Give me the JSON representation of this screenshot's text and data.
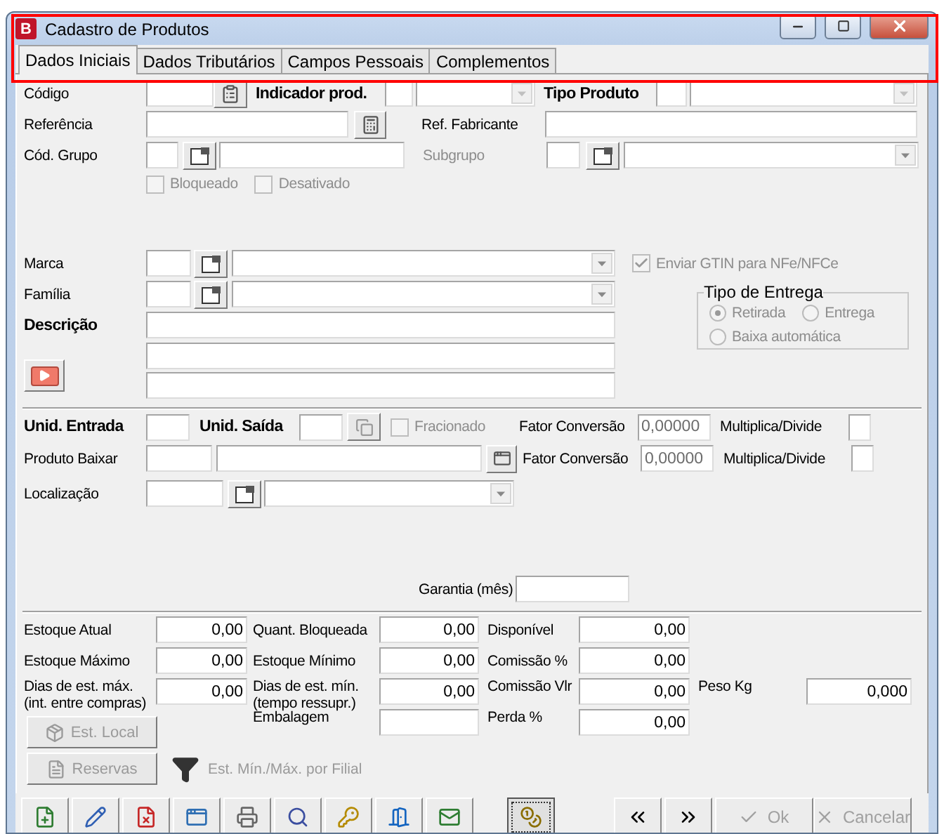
{
  "window": {
    "badge": "B",
    "title": "Cadastro de Produtos"
  },
  "tabs": [
    {
      "label": "Dados Iniciais",
      "selected": true
    },
    {
      "label": "Dados Tributários",
      "selected": false
    },
    {
      "label": "Campos Pessoais",
      "selected": false
    },
    {
      "label": "Complementos",
      "selected": false
    }
  ],
  "header": {
    "codigo_label": "Código",
    "indicador_label": "Indicador prod.",
    "tipo_label": "Tipo Produto",
    "referencia_label": "Referência",
    "ref_fabricante_label": "Ref. Fabricante",
    "cod_grupo_label": "Cód. Grupo",
    "subgrupo": {
      "label": "Subgrupo",
      "disabled": true
    }
  },
  "status_checks": [
    {
      "label": "Bloqueado",
      "checked": false,
      "disabled": true
    },
    {
      "label": "Desativado",
      "checked": false,
      "disabled": true
    }
  ],
  "product": {
    "marca_label": "Marca",
    "familia_label": "Família",
    "descricao_label": "Descrição"
  },
  "gtin": {
    "label": "Enviar GTIN para NFe/NFCe",
    "checked": true,
    "disabled": true
  },
  "tipo_entrega": {
    "title": "Tipo de Entrega",
    "disabled": true,
    "options": [
      {
        "label": "Retirada",
        "selected": true
      },
      {
        "label": "Entrega",
        "selected": false
      },
      {
        "label": "Baixa automática",
        "selected": false
      }
    ]
  },
  "unidades": {
    "entrada_label": "Unid. Entrada",
    "saida_label": "Unid. Saída",
    "fracionado": {
      "label": "Fracionado",
      "checked": false,
      "disabled": true
    },
    "produto_baixar_label": "Produto Baixar",
    "localizacao_label": "Localização",
    "conversions": [
      {
        "label": "Fator Conversão",
        "value": "0,00000",
        "mult_label": "Multiplica/Divide"
      },
      {
        "label": "Fator Conversão",
        "value": "0,00000",
        "mult_label": "Multiplica/Divide"
      }
    ]
  },
  "garantia_label": "Garantia (mês)",
  "stock": {
    "rows": [
      [
        {
          "label": "Estoque Atual",
          "value": "0,00"
        },
        {
          "label": "Quant. Bloqueada",
          "value": "0,00"
        },
        {
          "label": "Disponível",
          "value": "0,00"
        }
      ],
      [
        {
          "label": "Estoque Máximo",
          "value": "0,00"
        },
        {
          "label": "Estoque Mínimo",
          "value": "0,00"
        },
        {
          "label": "Comissão %",
          "value": "0,00"
        }
      ],
      [
        {
          "label": "Dias de est. máx.\n(int. entre compras)",
          "value": "0,00"
        },
        {
          "label": "Dias de est. mín.\n(tempo ressupr.)",
          "value": "0,00"
        },
        {
          "label": "Comissão Vlr",
          "value": "0,00"
        },
        {
          "label": "Peso Kg",
          "value": "0,000"
        }
      ]
    ],
    "bottom_cells": [
      {
        "label": "Embalagem"
      },
      {
        "label": "Perda %",
        "value": "0,00"
      }
    ],
    "buttons": [
      {
        "kind": "local",
        "label": "Est. Local",
        "disabled": true
      },
      {
        "kind": "reserve",
        "label": "Reservas",
        "disabled": true
      }
    ],
    "filial": {
      "label": "Est. Mín./Máx. por Filial",
      "disabled": true
    }
  },
  "toolbar": {
    "tools": [
      {
        "kind": "add",
        "focused": false
      },
      {
        "kind": "edit",
        "focused": false
      },
      {
        "kind": "delete",
        "focused": false
      },
      {
        "kind": "form",
        "focused": false
      },
      {
        "kind": "print",
        "focused": false
      },
      {
        "kind": "search",
        "focused": false
      },
      {
        "kind": "keys",
        "focused": false
      },
      {
        "kind": "exit",
        "focused": false
      },
      {
        "kind": "mail",
        "focused": false
      },
      {
        "kind": "coins",
        "focused": true
      }
    ],
    "nav": [
      {
        "kind": "previous"
      },
      {
        "kind": "next"
      }
    ],
    "actions": [
      {
        "kind": "ok",
        "label": "Ok",
        "disabled": true
      },
      {
        "kind": "cancel",
        "label": "Cancelar",
        "disabled": true
      }
    ]
  }
}
